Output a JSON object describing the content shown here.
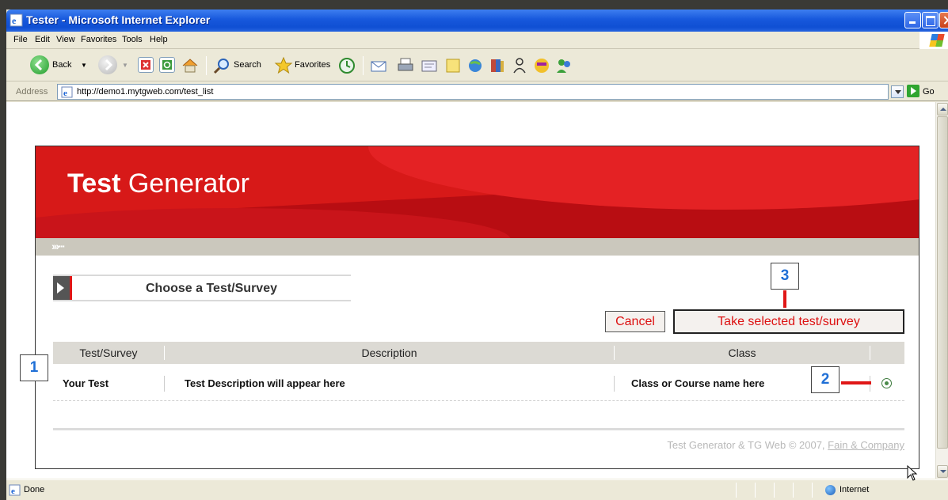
{
  "window": {
    "title": "Tester - Microsoft Internet Explorer"
  },
  "menu": [
    "File",
    "Edit",
    "View",
    "Favorites",
    "Tools",
    "Help"
  ],
  "toolbar": {
    "back": "Back",
    "search": "Search",
    "favorites": "Favorites"
  },
  "address": {
    "label": "Address",
    "url": "http://demo1.mytgweb.com/test_list",
    "go": "Go"
  },
  "page": {
    "brand_bold": "Test",
    "brand_rest": " Generator",
    "section_title": "Choose a Test/Survey",
    "cancel_label": "Cancel",
    "take_label": "Take selected test/survey",
    "table": {
      "headers": [
        "Test/Survey",
        "Description",
        "Class"
      ],
      "row": {
        "name": "Your Test",
        "description": "Test Description will appear here",
        "class": "Class or Course name here",
        "selected": true
      }
    },
    "footer_text": "Test Generator & TG Web © 2007, ",
    "footer_link": "Fain & Company"
  },
  "callouts": [
    "1",
    "2",
    "3"
  ],
  "status": {
    "text": "Done",
    "zone": "Internet"
  },
  "colors": {
    "brand_red": "#d71918",
    "callout_blue": "#1f6fd6",
    "button_text": "#dd1111"
  }
}
